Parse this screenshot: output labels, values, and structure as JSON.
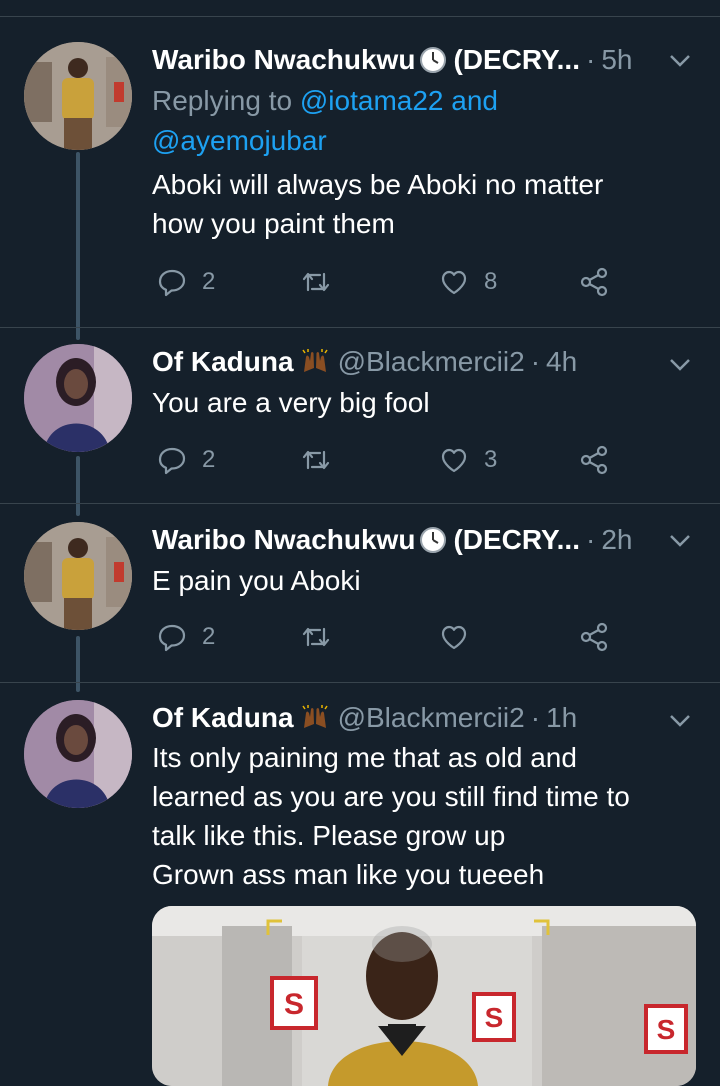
{
  "colors": {
    "background": "#15202b",
    "text": "#ffffff",
    "muted": "#8899a6",
    "link": "#1da1f2",
    "thread": "#3d5466"
  },
  "tweets": [
    {
      "name": "Waribo Nwachukwu",
      "badge_icon": "clock-emoji",
      "name_suffix": "(DECRY...",
      "handle": "",
      "time": "5h",
      "replying_prefix": "Replying to ",
      "replying_mention_1": "@iotama22",
      "replying_and": " and",
      "replying_mention_2": "@ayemojubar",
      "text_lines": [
        "Aboki will always be Aboki no matter",
        "how you paint them"
      ],
      "replies": "2",
      "retweets": "",
      "likes": "8"
    },
    {
      "name": "Of Kaduna",
      "badge_icon": "raised-hands-emoji",
      "handle": "@Blackmercii2",
      "time": "4h",
      "text_lines": [
        "You are a very big fool"
      ],
      "replies": "2",
      "retweets": "",
      "likes": "3"
    },
    {
      "name": "Waribo Nwachukwu",
      "badge_icon": "clock-emoji",
      "name_suffix": "(DECRY...",
      "handle": "",
      "time": "2h",
      "text_lines": [
        "E pain you Aboki"
      ],
      "replies": "2",
      "retweets": "",
      "likes": ""
    },
    {
      "name": "Of Kaduna",
      "badge_icon": "raised-hands-emoji",
      "handle": "@Blackmercii2",
      "time": "1h",
      "text_lines": [
        "Its only paining me that as old and",
        "learned as you are you still find time to",
        "talk like this. Please grow up",
        "Grown ass man like you tueeeh"
      ],
      "replies": "",
      "retweets": "",
      "likes": ""
    }
  ],
  "dot": "·"
}
